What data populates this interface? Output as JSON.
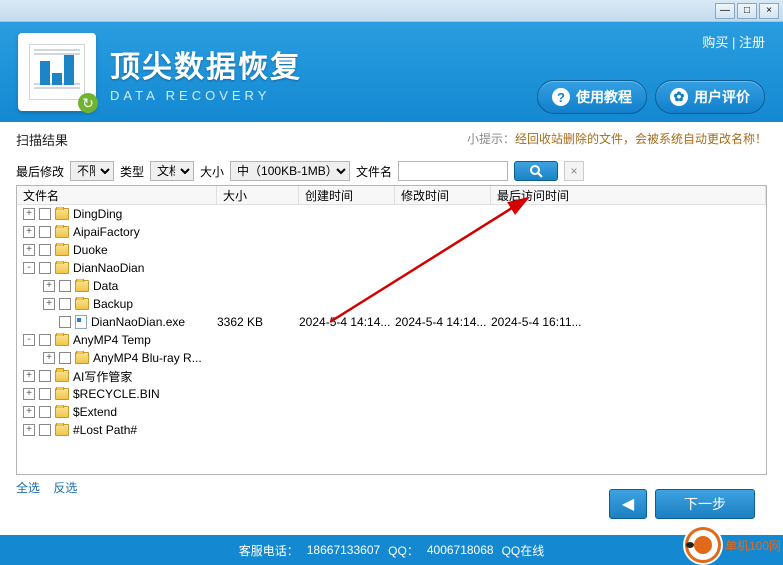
{
  "window": {
    "minimize": "—",
    "maximize": "□",
    "close": "×"
  },
  "header": {
    "title_cn": "顶尖数据恢复",
    "title_en": "DATA RECOVERY",
    "buy": "购买",
    "register": "注册",
    "sep": " | ",
    "tutorial": "使用教程",
    "review": "用户评价"
  },
  "scan": {
    "title": "扫描结果",
    "hint_pre": "小提示：",
    "hint_main": "经回收站删除的文件，会被系统自动更改名称！"
  },
  "filters": {
    "last_modify_label": "最后修改",
    "last_modify_value": "不限",
    "type_label": "类型",
    "type_value": "文档",
    "size_label": "大小",
    "size_value": "中（100KB-1MB）",
    "filename_label": "文件名"
  },
  "columns": {
    "name": "文件名",
    "size": "大小",
    "create": "创建时间",
    "modify": "修改时间",
    "access": "最后访问时间"
  },
  "tree": [
    {
      "level": 1,
      "exp": "+",
      "type": "folder",
      "name": "DingDing"
    },
    {
      "level": 1,
      "exp": "+",
      "type": "folder",
      "name": "AipaiFactory"
    },
    {
      "level": 1,
      "exp": "+",
      "type": "folder",
      "name": "Duoke"
    },
    {
      "level": 1,
      "exp": "-",
      "type": "folder",
      "name": "DianNaoDian"
    },
    {
      "level": 2,
      "exp": "+",
      "type": "folder",
      "name": "Data"
    },
    {
      "level": 2,
      "exp": "+",
      "type": "folder",
      "name": "Backup"
    },
    {
      "level": 2,
      "exp": "",
      "type": "file",
      "name": "DianNaoDian.exe",
      "size": "3362 KB",
      "create": "2024-5-4 14:14...",
      "modify": "2024-5-4 14:14...",
      "access": "2024-5-4 16:11..."
    },
    {
      "level": 1,
      "exp": "-",
      "type": "folder",
      "name": "AnyMP4 Temp"
    },
    {
      "level": 2,
      "exp": "+",
      "type": "folder",
      "name": "AnyMP4 Blu-ray R..."
    },
    {
      "level": 1,
      "exp": "+",
      "type": "folder",
      "name": "AI写作管家"
    },
    {
      "level": 1,
      "exp": "+",
      "type": "folder",
      "name": "$RECYCLE.BIN"
    },
    {
      "level": 1,
      "exp": "+",
      "type": "folder",
      "name": "$Extend"
    },
    {
      "level": 1,
      "exp": "+",
      "type": "folder",
      "name": "#Lost Path#"
    }
  ],
  "select": {
    "all": "全选",
    "invert": "反选"
  },
  "nav": {
    "back": "◀",
    "next": "下一步"
  },
  "footer": {
    "tel_label": "客服电话：",
    "tel": "18667133607",
    "qq_label": "QQ：",
    "qq": "4006718068",
    "qq_online": "QQ在线"
  },
  "watermark": "单机100网"
}
